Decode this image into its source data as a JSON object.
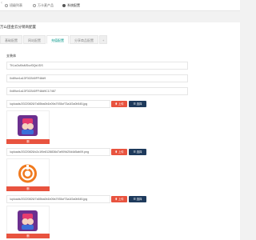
{
  "topnav": {
    "arrow_left": "‹",
    "tabs": [
      {
        "label": "班级列表",
        "active": false
      },
      {
        "label": "万卡麦产品",
        "active": false
      },
      {
        "label": "系统配置",
        "active": true
      }
    ]
  },
  "panel": {
    "title": "万山田金云分销商配置",
    "sub_tabs": [
      "基础配置",
      "网站配置",
      "充值配置",
      "分享商品配置"
    ],
    "add_tab": "+"
  },
  "section": {
    "label": "支装体"
  },
  "fields": [
    "TKLsGsf0sMSxzf3QsVDS",
    "0x89ce1a13F3CB40FF48d9",
    "0x89ce1a13F3CB40FF48d9C17467"
  ],
  "uploads": [
    {
      "path": "/uploads/20220826/7a55ba0b1b09a7935cf73a1f2a0b545.jpg",
      "icon": "app-avatar-icon"
    },
    {
      "path": "/uploads/20220826/c2c1f0e8128836d7a909d20d4d5ab09.png",
      "icon": "orange-swirl-logo-icon"
    },
    {
      "path": "/uploads/20220826/7a55ba0b1b09a7935cf73a1f2a0b545.jpg",
      "icon": "app-avatar-icon"
    }
  ],
  "buttons": {
    "upload": "⬆ 上传",
    "choose": "☰ 选择",
    "delete": "删"
  },
  "colors": {
    "accent_teal": "#009688",
    "upload_red": "#e8533f",
    "choose_navy": "#1e3a5c"
  }
}
